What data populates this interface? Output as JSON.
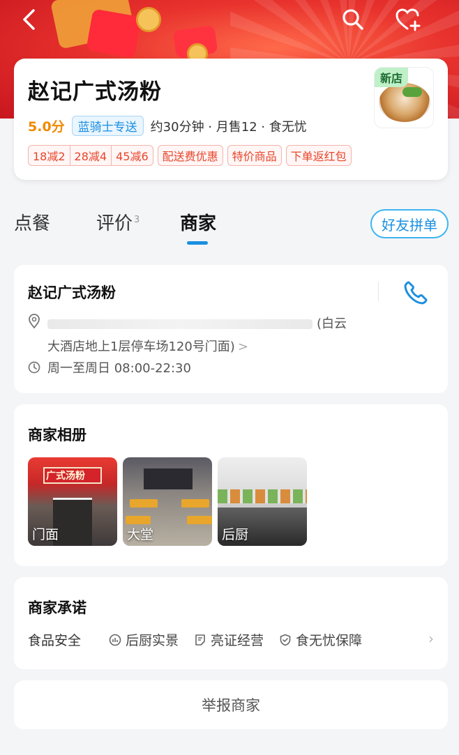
{
  "header": {
    "back_icon": "chevron-left-icon",
    "search_icon": "search-icon",
    "favorite_icon": "heart-plus-icon"
  },
  "shop": {
    "name": "赵记广式汤粉",
    "new_badge": "新店",
    "rating": "5.0分",
    "delivery_tag": "蓝骑士专送",
    "meta": "约30分钟 · 月售12 · 食无忧",
    "discounts": [
      "18减2",
      "28减4",
      "45减6"
    ],
    "promos": [
      "配送费优惠",
      "特价商品",
      "下单返红包"
    ]
  },
  "tabs": {
    "order": "点餐",
    "review": "评价",
    "review_count": "3",
    "merchant": "商家",
    "group_order_button": "好友拼单"
  },
  "merchant_info": {
    "name": "赵记广式汤粉",
    "address_visible_end_line1": "(白云",
    "address_line2": "大酒店地上1层停车场120号门面)",
    "hours": "周一至周日 08:00-22:30"
  },
  "album": {
    "title": "商家相册",
    "photos": [
      {
        "label": "门面"
      },
      {
        "label": "大堂"
      },
      {
        "label": "后厨"
      }
    ],
    "door_sign_text": "广式汤粉"
  },
  "promise": {
    "title": "商家承诺",
    "category": "食品安全",
    "items": [
      "后厨实景",
      "亮证经营",
      "食无忧保障"
    ]
  },
  "report": {
    "label": "举报商家"
  },
  "colors": {
    "accent_blue": "#1a8fe0",
    "rating_orange": "#f08a00",
    "promo_red": "#e8452c",
    "hero_red": "#e8322d"
  }
}
